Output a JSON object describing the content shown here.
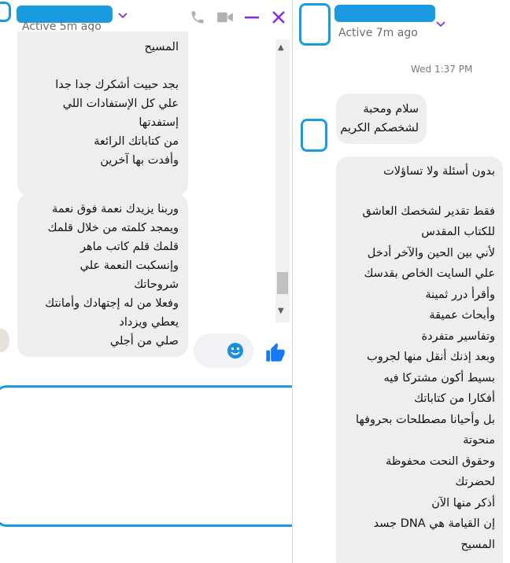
{
  "left_chat": {
    "status": "Active 5m ago",
    "message_top": [
      "المسيح",
      "",
      "بجد حبيت أشكرك جدا جدا",
      "علي كل الإستفادات اللي",
      "إستفدتها",
      "من كتاباتك الرائعة",
      "وأفدت بها آخرين"
    ],
    "message_bottom": [
      "وربنا يزيدك نعمة فوق نعمة",
      "ويمجد كلمته من خلال قلمك",
      "قلمك  قلم كاتب ماهر",
      "وإنسكبت النعمة علي",
      "شروحاتك",
      "وفعلا من له إجتهادك وأمانتك",
      "يعطي ويزداد",
      "صلي من أجلي"
    ],
    "scroll_up_glyph": "▲",
    "scroll_down_glyph": "▼",
    "icons": [
      "chevron-down-icon",
      "phone-icon",
      "video-camera-icon",
      "minimize-icon",
      "close-icon",
      "emoji-icon",
      "thumbs-up-icon"
    ],
    "colors": {
      "accent": "#8a2be2",
      "redaction": "#1a9be0",
      "like": "#1877f2"
    }
  },
  "right_chat": {
    "status": "Active 7m ago",
    "timestamp": "Wed 1:37 PM",
    "message_greeting": [
      "سلام ومحبة",
      "لشخصكم الكريم"
    ],
    "message_long": [
      "بدون أسئلة ولا تساؤلات",
      "",
      "فقط تقدير لشخصك العاشق",
      "للكتاب المقدس",
      "لأني بين الحين والآخر أدخل",
      "علي السايت الخاص بقدسك",
      "وأقرأ درر ثمينة",
      "وأبحاث عميقة",
      "وتفاسير متفردة",
      "وبعد إذنك أنقل منها لجروب",
      "بسيط أكون مشتركا فيه",
      "أفكارا من كتاباتك",
      "بل وأحيانا مصطلحات بحروفها",
      "منحوتة",
      "وحقوق النحت محفوظة",
      "لحضرتك",
      "أذكر منها الآن",
      "إن القيامة هي DNA جسد",
      "المسيح"
    ],
    "icons": [
      "chevron-down-icon"
    ]
  }
}
